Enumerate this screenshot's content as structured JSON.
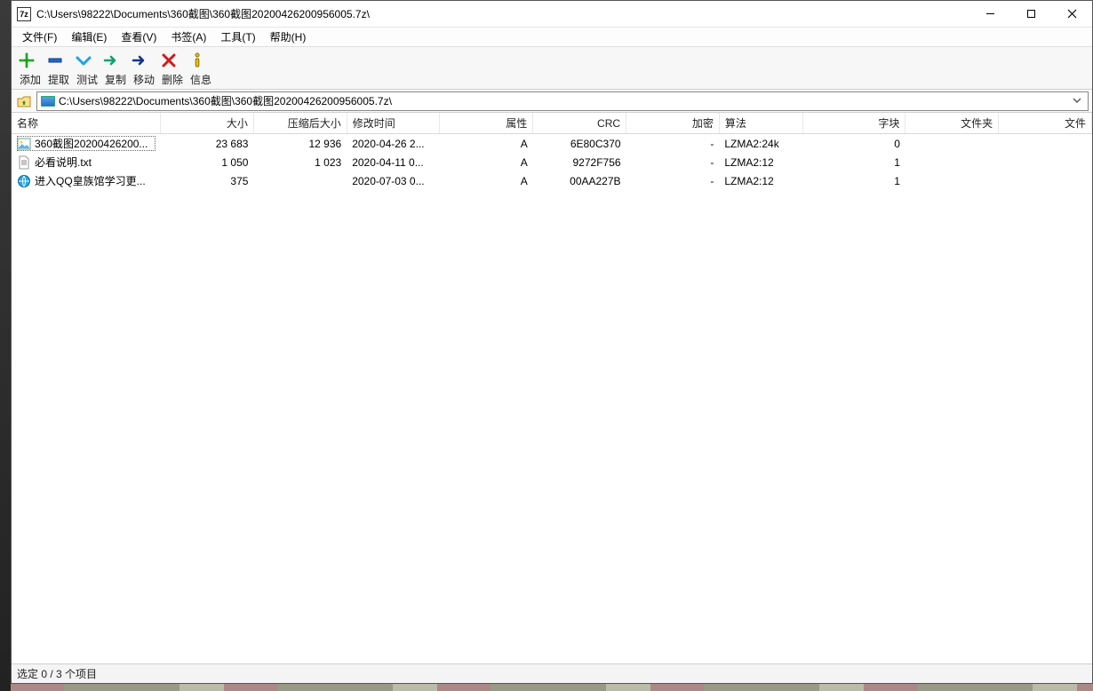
{
  "window": {
    "app_icon_label": "7z",
    "title": "C:\\Users\\98222\\Documents\\360截图\\360截图20200426200956005.7z\\"
  },
  "menus": {
    "file": "文件(F)",
    "edit": "编辑(E)",
    "view": "查看(V)",
    "bookmarks": "书签(A)",
    "tools": "工具(T)",
    "help": "帮助(H)"
  },
  "toolbar_labels": {
    "add": "添加",
    "extract": "提取",
    "test": "测试",
    "copy": "复制",
    "move": "移动",
    "delete": "删除",
    "info": "信息"
  },
  "address": {
    "value": "C:\\Users\\98222\\Documents\\360截图\\360截图20200426200956005.7z\\"
  },
  "columns": {
    "name": "名称",
    "size": "大小",
    "packed": "压缩后大小",
    "modified": "修改时间",
    "attributes": "属性",
    "crc": "CRC",
    "encrypted": "加密",
    "method": "算法",
    "block": "字块",
    "folders": "文件夹",
    "files": "文件"
  },
  "rows": [
    {
      "icon": "image",
      "name": "360截图20200426200...",
      "size": "23 683",
      "packed": "12 936",
      "modified": "2020-04-26 2...",
      "attributes": "A",
      "crc": "6E80C370",
      "encrypted": "-",
      "method": "LZMA2:24k",
      "block": "0",
      "folders": "",
      "files": "",
      "selected": true
    },
    {
      "icon": "txt",
      "name": "必看说明.txt",
      "size": "1 050",
      "packed": "1 023",
      "modified": "2020-04-11 0...",
      "attributes": "A",
      "crc": "9272F756",
      "encrypted": "-",
      "method": "LZMA2:12",
      "block": "1",
      "folders": "",
      "files": "",
      "selected": false
    },
    {
      "icon": "url",
      "name": "进入QQ皇族馆学习更...",
      "size": "375",
      "packed": "",
      "modified": "2020-07-03 0...",
      "attributes": "A",
      "crc": "00AA227B",
      "encrypted": "-",
      "method": "LZMA2:12",
      "block": "1",
      "folders": "",
      "files": "",
      "selected": false
    }
  ],
  "status": {
    "text": "选定 0 / 3 个项目"
  }
}
